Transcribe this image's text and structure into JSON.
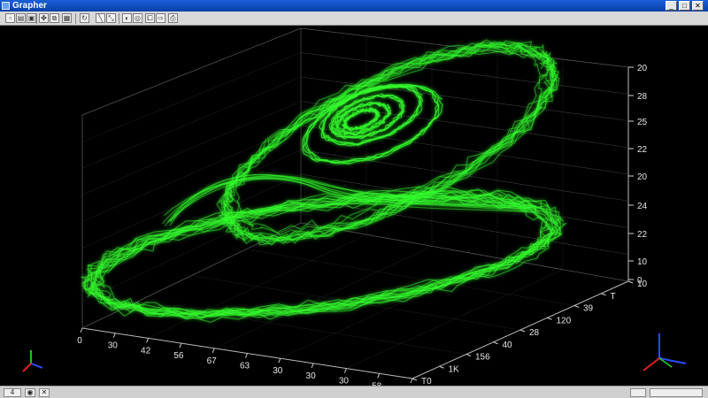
{
  "window": {
    "title": "Grapher",
    "buttons": {
      "minimize": "_",
      "maximize": "□",
      "close": "✕"
    }
  },
  "toolbar": {
    "buttons": [
      {
        "icon": "new-icon",
        "glyph": "▫"
      },
      {
        "icon": "open-icon",
        "glyph": "▤"
      },
      {
        "icon": "save-icon",
        "glyph": "▣"
      },
      {
        "icon": "tools-icon",
        "glyph": "✤"
      },
      {
        "icon": "duplicate-icon",
        "glyph": "⧉"
      },
      {
        "icon": "image-icon",
        "glyph": "▦"
      },
      {
        "icon": "rotate-icon",
        "glyph": "↻"
      },
      {
        "icon": "line-icon",
        "glyph": "╲"
      },
      {
        "icon": "measure-icon",
        "glyph": "⤡"
      },
      {
        "icon": "pan-icon",
        "glyph": "◐"
      },
      {
        "icon": "zoom-icon",
        "glyph": "◎"
      },
      {
        "icon": "copy-icon",
        "glyph": "⧠"
      },
      {
        "icon": "export-icon",
        "glyph": "⇨"
      },
      {
        "icon": "print-icon",
        "glyph": "⎙"
      }
    ]
  },
  "plot": {
    "trace_color": "#34ff2e",
    "axis_color": "#cfcfcf",
    "z_ticks": [
      "20",
      "28",
      "25",
      "22",
      "20",
      "24",
      "22",
      "10",
      "0"
    ],
    "x_ticks": [
      "0",
      "30",
      "42",
      "56",
      "67",
      "63",
      "30",
      "30",
      "30",
      "58",
      "0"
    ],
    "y_ticks": [
      "10",
      "T",
      "39",
      "120",
      "28",
      "40",
      "156",
      "1K",
      "T0"
    ]
  },
  "status": {
    "items": [
      "4",
      "◉",
      "✕"
    ]
  }
}
